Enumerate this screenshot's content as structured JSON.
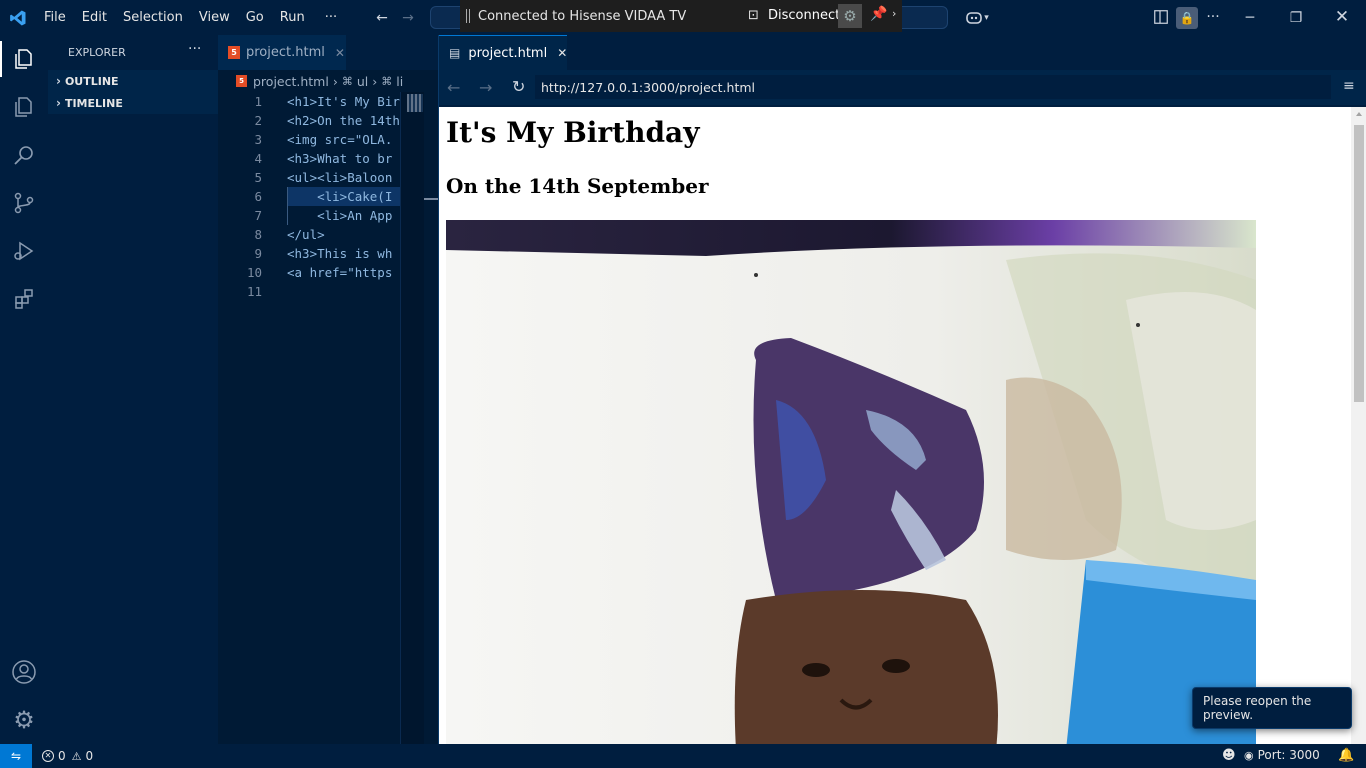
{
  "titlebar": {
    "menu": [
      "File",
      "Edit",
      "Selection",
      "View",
      "Go",
      "Run",
      "···"
    ],
    "remote_banner": "Connected to Hisense VIDAA TV",
    "disconnect_label": "Disconnect"
  },
  "sidebar": {
    "title": "EXPLORER",
    "sections": [
      "OUTLINE",
      "TIMELINE"
    ]
  },
  "editor": {
    "tab_label": "project.html",
    "breadcrumb": {
      "file": "project.html",
      "seg1": "ul",
      "seg2": "li"
    },
    "lines": [
      {
        "n": "1",
        "code": "<h1>It's My Bir"
      },
      {
        "n": "2",
        "code": "<h2>On the 14th"
      },
      {
        "n": "3",
        "code": "<img src=\"OLA."
      },
      {
        "n": "4",
        "code": "<h3>What to br"
      },
      {
        "n": "5",
        "code": "<ul><li>Baloon"
      },
      {
        "n": "6",
        "code": "    <li>Cake(I"
      },
      {
        "n": "7",
        "code": "    <li>An App"
      },
      {
        "n": "8",
        "code": "</ul>"
      },
      {
        "n": "9",
        "code": "<h3>This is wh"
      },
      {
        "n": "10",
        "code": "<a href=\"https"
      },
      {
        "n": "11",
        "code": ""
      }
    ]
  },
  "preview": {
    "tab_label": "project.html",
    "url": "http://127.0.0.1:3000/project.html",
    "heading1": "It's My Birthday",
    "heading2": "On the 14th September",
    "toast": "Please reopen the preview."
  },
  "statusbar": {
    "errors": "0",
    "warnings": "0",
    "port": "Port: 3000"
  },
  "colors": {
    "background": "#001e3f",
    "accent": "#0078d4"
  }
}
